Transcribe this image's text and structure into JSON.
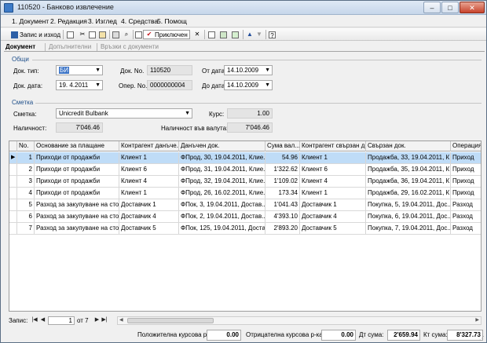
{
  "window": {
    "title": "110520 - Банково извлечение",
    "controls": {
      "minimize": "–",
      "maximize": "□",
      "close": "✕"
    }
  },
  "menu": {
    "items": [
      "1. Документ",
      "2. Редакция",
      "3. Изглед",
      "4. Средства",
      "5. Помощ"
    ]
  },
  "toolbar": {
    "save_exit_label": "Запис и изход",
    "confirm_label": "Приключен",
    "delete_symbol": "✕"
  },
  "tabs": [
    "Документ",
    "Допълнителни",
    "Връзки с документи"
  ],
  "general": {
    "group_label": "Общи",
    "doc_type_label": "Док. тип:",
    "doc_type_value": "БИ",
    "doc_no_label": "Док. No.",
    "doc_no_value": "110520",
    "from_date_label": "От дата:",
    "from_date_value": "14.10.2009",
    "doc_date_label": "Док. дата:",
    "doc_date_value": "19. 4.2011",
    "oper_no_label": "Опер. No.",
    "oper_no_value": "0000000004",
    "to_date_label": "До дата:",
    "to_date_value": "14.10.2009"
  },
  "account": {
    "group_label": "Сметка",
    "account_label": "Сметка:",
    "account_value": "Unicredit Bulbank",
    "rate_label": "Курс:",
    "rate_value": "1.00",
    "balance_label": "Наличност:",
    "balance_value": "7'046.46",
    "balance_cur_label": "Наличност във валута:",
    "balance_cur_value": "7'046.46"
  },
  "grid": {
    "columns": [
      "No.",
      "Основание за плащане",
      "Контрагент данъче...",
      "Данъчен док.",
      "Сума вал...",
      "Контрагент свързан д...",
      "Свързан док.",
      "Операция"
    ],
    "rows": [
      [
        "1",
        "Приходи от продажби",
        "Клиент 1",
        "ФПрод, 30, 19.04.2011, Клие...",
        "54.96",
        "Клиент 1",
        "Продажба, 33, 19.04.2011, К...",
        "Приход"
      ],
      [
        "2",
        "Приходи от продажби",
        "Клиент 6",
        "ФПрод, 31, 19.04.2011, Клие...",
        "1'322.62",
        "Клиент 6",
        "Продажба, 35, 19.04.2011, К...",
        "Приход"
      ],
      [
        "3",
        "Приходи от продажби",
        "Клиент 4",
        "ФПрод, 32, 19.04.2011, Клие...",
        "1'109.02",
        "Клиент 4",
        "Продажба, 36, 19.04.2011, К...",
        "Приход"
      ],
      [
        "4",
        "Приходи от продажби",
        "Клиент 1",
        "ФПрод, 26, 16.02.2011, Клие...",
        "173.34",
        "Клиент 1",
        "Продажба, 29, 16.02.2011, К...",
        "Приход"
      ],
      [
        "5",
        "Разход за закупуване на сто...",
        "Доставчик 1",
        "ФПок, 3, 19.04.2011, Достав...",
        "1'041.43",
        "Доставчик 1",
        "Покупка, 5, 19.04.2011, Дос...",
        "Разход"
      ],
      [
        "6",
        "Разход за закупуване на сто...",
        "Доставчик 4",
        "ФПок, 2, 19.04.2011, Достав...",
        "4'393.10",
        "Доставчик 4",
        "Покупка, 6, 19.04.2011, Дос...",
        "Разход"
      ],
      [
        "7",
        "Разход за закупуване на сто...",
        "Доставчик 5",
        "ФПок, 125, 19.04.2011, Доста...",
        "2'893.20",
        "Доставчик 5",
        "Покупка, 7, 19.04.2011, Дос...",
        "Разход"
      ]
    ],
    "selected_row_marker": "▶"
  },
  "navigator": {
    "record_label": "Запис:",
    "current": "1",
    "of_label": "от 7"
  },
  "footer": {
    "pos_rate_label": "Положителна курсова р-ка:",
    "pos_rate_value": "0.00",
    "neg_rate_label": "Отрицателна курсова р-ка:",
    "neg_rate_value": "0.00",
    "dt_label": "Дт сума:",
    "dt_value": "2'659.94",
    "kt_label": "Кт сума:",
    "kt_value": "8'327.73"
  }
}
